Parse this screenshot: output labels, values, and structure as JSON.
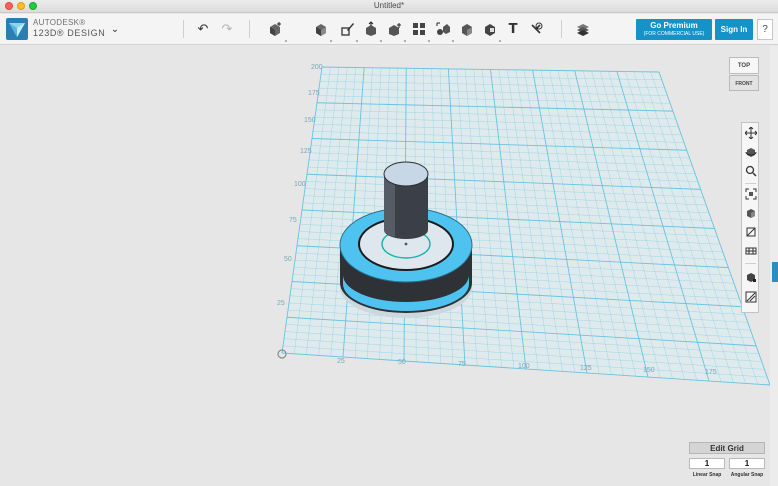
{
  "window": {
    "title": "Untitled*"
  },
  "app": {
    "brand_line1": "AUTODESK®",
    "brand_line2": "123D® DESIGN",
    "menu_glyph": "⌄"
  },
  "toolbar": {
    "undo_glyph": "↶",
    "redo_glyph": "↷",
    "text_glyph": "T",
    "premium_label": "Go Premium",
    "premium_sublabel": "(FOR COMMERCIAL USE)",
    "signin_label": "Sign In",
    "help_label": "?"
  },
  "viewcube": {
    "top_label": "TOP",
    "front_label": "FRONT"
  },
  "grid": {
    "y_ticks": [
      "200",
      "175",
      "150",
      "125",
      "100",
      "75",
      "50",
      "25"
    ],
    "x_ticks": [
      "25",
      "50",
      "75",
      "100",
      "125",
      "150",
      "175"
    ]
  },
  "edit_grid": {
    "button_label": "Edit Grid",
    "linear_snap_value": "1",
    "angular_snap_value": "1",
    "linear_snap_label": "Linear Snap",
    "angular_snap_label": "Angular Snap"
  },
  "colors": {
    "accent": "#1592c8",
    "grid_line": "#5bbfe0",
    "ring": "#4fc3f0"
  }
}
